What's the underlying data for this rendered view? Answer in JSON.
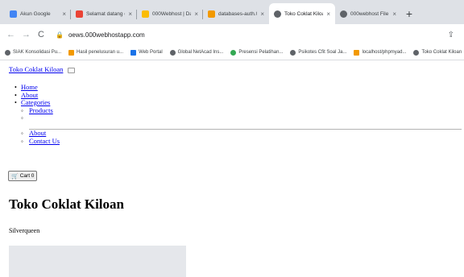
{
  "browser": {
    "tabs": [
      {
        "label": "Akun Google",
        "favicon_color": "#4285f4",
        "favicon_glyph": "G"
      },
      {
        "label": "Selamat datang di 000",
        "favicon_color": "#ea4335",
        "favicon_glyph": "M"
      },
      {
        "label": "000Webhost | Databa",
        "favicon_color": "#fbbc04",
        "favicon_glyph": "☁"
      },
      {
        "label": "databases-auth.000we",
        "favicon_color": "#f29900",
        "favicon_glyph": "▲"
      },
      {
        "label": "Toko Coklat Kiloan",
        "favicon_color": "#5f6368",
        "favicon_glyph": "◉"
      },
      {
        "label": "000webhost File Man",
        "favicon_color": "#5f6368",
        "favicon_glyph": "◉"
      }
    ],
    "new_tab_label": "+",
    "url": "oews.000webhostapp.com",
    "bookmarks": [
      {
        "label": "SIAK Konsolidasi Pu...",
        "color": "#5f6368"
      },
      {
        "label": "Hasil penelusuran u...",
        "color": "#f29900"
      },
      {
        "label": "Web Portal",
        "color": "#1a73e8"
      },
      {
        "label": "Global NetAcad Ins...",
        "color": "#5f6368"
      },
      {
        "label": "Presensi Pelatihan...",
        "color": "#34a853"
      },
      {
        "label": "Psikotes Cfit Soal Ja...",
        "color": "#5f6368"
      },
      {
        "label": "localhost/phpmyad...",
        "color": "#f29900"
      },
      {
        "label": "Toko Coklat Kiloan",
        "color": "#5f6368"
      }
    ]
  },
  "site": {
    "brand": "Toko Coklat Kiloan",
    "nav": {
      "home": "Home",
      "about": "About",
      "categories": "Categories",
      "products": "Products",
      "sub_about": "About",
      "contact": "Contact Us"
    },
    "cart_label": "Cart 0",
    "heading": "Toko Coklat Kiloan",
    "product_name": "Silverqueen"
  }
}
